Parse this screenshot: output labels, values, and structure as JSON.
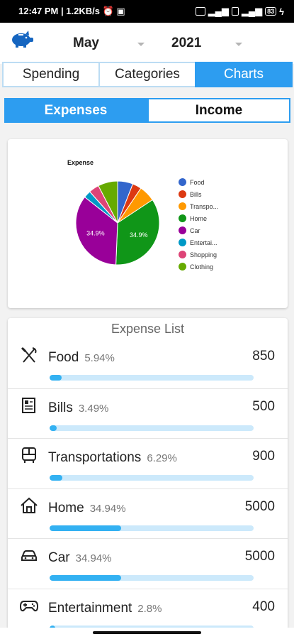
{
  "status": {
    "time": "12:47 PM",
    "speed": "1.2KB/s",
    "battery": "83"
  },
  "header": {
    "month": "May",
    "year": "2021"
  },
  "tabs": [
    {
      "label": "Spending",
      "active": false
    },
    {
      "label": "Categories",
      "active": false
    },
    {
      "label": "Charts",
      "active": true
    }
  ],
  "toggle": {
    "expenses": "Expenses",
    "income": "Income"
  },
  "chart_data": {
    "type": "pie",
    "title": "Expense",
    "categories": [
      "Food",
      "Bills",
      "Transpo...",
      "Home",
      "Car",
      "Entertai...",
      "Shopping",
      "Clothing"
    ],
    "values": [
      5.94,
      3.49,
      6.29,
      34.94,
      34.94,
      2.8,
      4.0,
      7.6
    ],
    "colors": [
      "#3366cc",
      "#dc3912",
      "#ff9900",
      "#109618",
      "#990099",
      "#0099c6",
      "#dd4477",
      "#66aa00"
    ],
    "data_labels": [
      "",
      "",
      "",
      "34.9%",
      "34.9%",
      "",
      "",
      ""
    ],
    "legend_position": "right"
  },
  "expense_list": {
    "title": "Expense List",
    "items": [
      {
        "name": "Food",
        "percent": "5.94%",
        "amount": "850",
        "fraction": 0.0594,
        "icon": "fork-knife-icon"
      },
      {
        "name": "Bills",
        "percent": "3.49%",
        "amount": "500",
        "fraction": 0.0349,
        "icon": "bill-icon"
      },
      {
        "name": "Transportations",
        "percent": "6.29%",
        "amount": "900",
        "fraction": 0.0629,
        "icon": "bus-icon"
      },
      {
        "name": "Home",
        "percent": "34.94%",
        "amount": "5000",
        "fraction": 0.3494,
        "icon": "house-icon"
      },
      {
        "name": "Car",
        "percent": "34.94%",
        "amount": "5000",
        "fraction": 0.3494,
        "icon": "car-icon"
      },
      {
        "name": "Entertainment",
        "percent": "2.8%",
        "amount": "400",
        "fraction": 0.028,
        "icon": "gamepad-icon"
      }
    ]
  }
}
